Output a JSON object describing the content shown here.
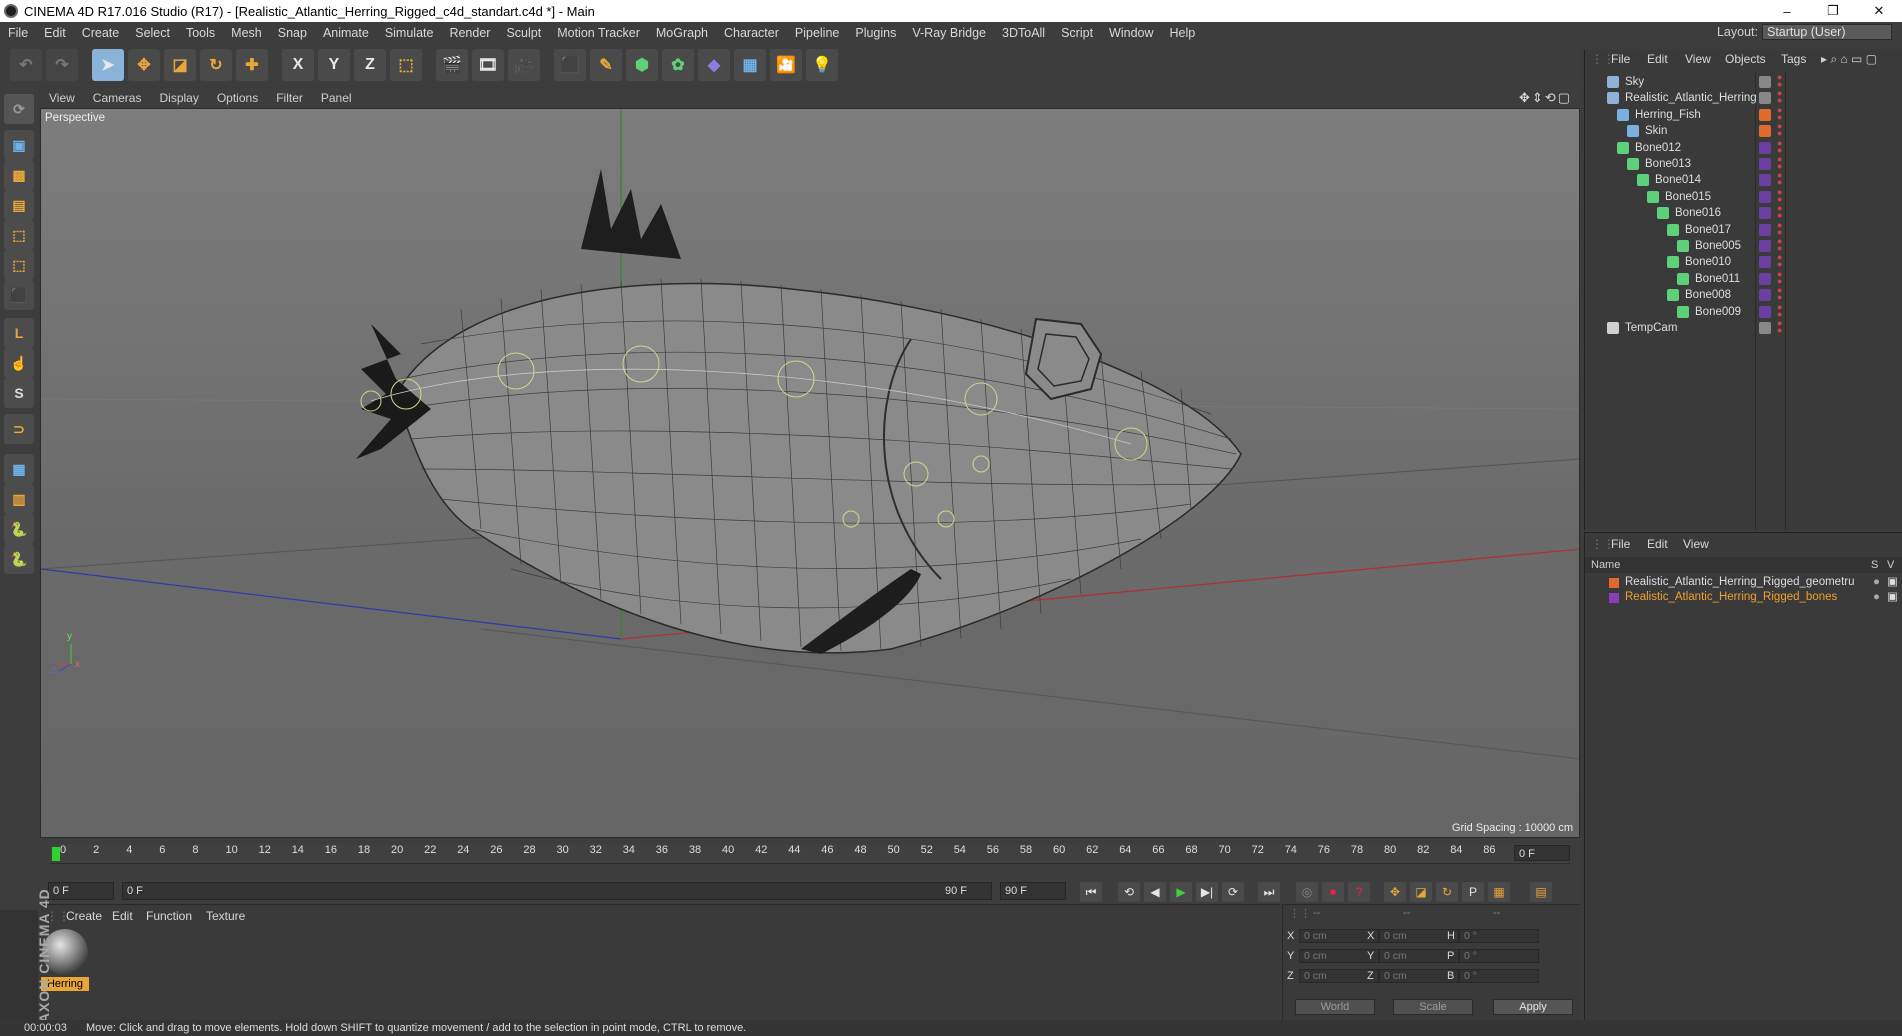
{
  "window": {
    "title": "CINEMA 4D R17.016 Studio (R17) - [Realistic_Atlantic_Herring_Rigged_c4d_standart.c4d *] - Main",
    "min": "–",
    "max": "❐",
    "close": "✕"
  },
  "menu": [
    "File",
    "Edit",
    "Create",
    "Select",
    "Tools",
    "Mesh",
    "Snap",
    "Animate",
    "Simulate",
    "Render",
    "Sculpt",
    "Motion Tracker",
    "MoGraph",
    "Character",
    "Pipeline",
    "Plugins",
    "V-Ray Bridge",
    "3DToAll",
    "Script",
    "Window",
    "Help"
  ],
  "layout": {
    "label": "Layout:",
    "value": "Startup (User)"
  },
  "toolbar": {
    "axis": [
      "X",
      "Y",
      "Z"
    ]
  },
  "viewport": {
    "menu": [
      "View",
      "Cameras",
      "Display",
      "Options",
      "Filter",
      "Panel"
    ],
    "label": "Perspective",
    "grid_spacing": "Grid Spacing : 10000 cm",
    "axis_x": "x",
    "axis_y": "y",
    "axis_z": "z"
  },
  "timeline": {
    "ticks": [
      "0",
      "2",
      "4",
      "6",
      "8",
      "10",
      "12",
      "14",
      "16",
      "18",
      "20",
      "22",
      "24",
      "26",
      "28",
      "30",
      "32",
      "34",
      "36",
      "38",
      "40",
      "42",
      "44",
      "46",
      "48",
      "50",
      "52",
      "54",
      "56",
      "58",
      "60",
      "62",
      "64",
      "66",
      "68",
      "70",
      "72",
      "74",
      "76",
      "78",
      "80",
      "82",
      "84",
      "86",
      "88",
      "90"
    ],
    "end_field": "0 F",
    "current_frame": "0 F",
    "range_start": "0 F",
    "range_end": "90 F",
    "max_frame": "90 F"
  },
  "material_manager": {
    "menu": [
      "Create",
      "Edit",
      "Function",
      "Texture"
    ],
    "materials": [
      {
        "name": "Herring"
      }
    ]
  },
  "brand": "MAXON CINEMA 4D",
  "coordinates": {
    "header": [
      "--",
      "--",
      "--"
    ],
    "rows": [
      {
        "l1": "X",
        "v1": "0 cm",
        "l2": "X",
        "v2": "0 cm",
        "l3": "H",
        "v3": "0 °"
      },
      {
        "l1": "Y",
        "v1": "0 cm",
        "l2": "Y",
        "v2": "0 cm",
        "l3": "P",
        "v3": "0 °"
      },
      {
        "l1": "Z",
        "v1": "0 cm",
        "l2": "Z",
        "v2": "0 cm",
        "l3": "B",
        "v3": "0 °"
      }
    ],
    "mode": "World",
    "scale": "Scale",
    "apply": "Apply"
  },
  "object_manager": {
    "menu": [
      "File",
      "Edit",
      "View",
      "Objects",
      "Tags"
    ],
    "objects": [
      {
        "name": "Sky",
        "indent": 0,
        "color": "#8fb3d6"
      },
      {
        "name": "Realistic_Atlantic_Herring",
        "indent": 0,
        "color": "#8fb3d6"
      },
      {
        "name": "Herring_Fish",
        "indent": 1,
        "color": "#7ab0e0"
      },
      {
        "name": "Skin",
        "indent": 2,
        "color": "#7ab0e0"
      },
      {
        "name": "Bone012",
        "indent": 1,
        "color": "#5fd07a"
      },
      {
        "name": "Bone013",
        "indent": 2,
        "color": "#5fd07a"
      },
      {
        "name": "Bone014",
        "indent": 3,
        "color": "#5fd07a"
      },
      {
        "name": "Bone015",
        "indent": 4,
        "color": "#5fd07a"
      },
      {
        "name": "Bone016",
        "indent": 5,
        "color": "#5fd07a"
      },
      {
        "name": "Bone017",
        "indent": 6,
        "color": "#5fd07a"
      },
      {
        "name": "Bone005",
        "indent": 7,
        "color": "#5fd07a"
      },
      {
        "name": "Bone010",
        "indent": 6,
        "color": "#5fd07a"
      },
      {
        "name": "Bone011",
        "indent": 7,
        "color": "#5fd07a"
      },
      {
        "name": "Bone008",
        "indent": 6,
        "color": "#5fd07a"
      },
      {
        "name": "Bone009",
        "indent": 7,
        "color": "#5fd07a"
      },
      {
        "name": "TempCam",
        "indent": 0,
        "color": "#cfcfcf"
      }
    ]
  },
  "layer_manager": {
    "menu": [
      "File",
      "Edit",
      "View"
    ],
    "header": {
      "name": "Name",
      "s": "S",
      "v": "V"
    },
    "layers": [
      {
        "name": "Realistic_Atlantic_Herring_Rigged_geometru",
        "color": "#e06a2c",
        "text_color": "#dedede"
      },
      {
        "name": "Realistic_Atlantic_Herring_Rigged_bones",
        "color": "#8a3fb8",
        "text_color": "#f0a030"
      }
    ]
  },
  "status": {
    "time": "00:00:03",
    "message": "Move: Click and drag to move elements. Hold down SHIFT to quantize movement / add to the selection in point mode, CTRL to remove."
  }
}
